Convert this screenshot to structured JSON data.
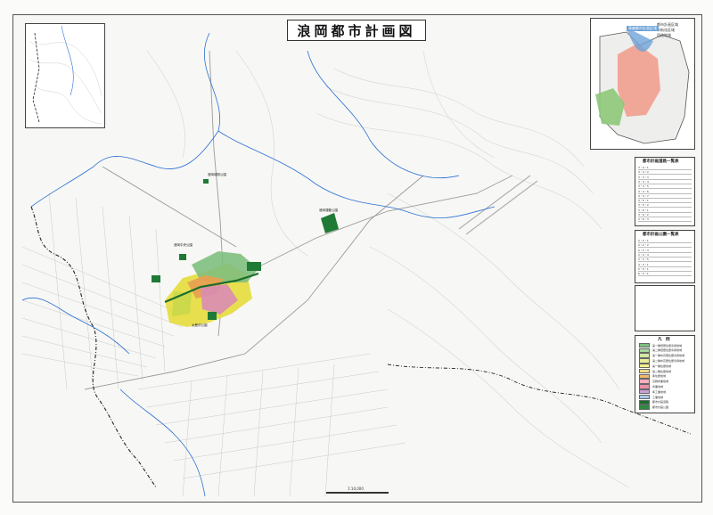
{
  "title": "浪岡都市計画図",
  "scale_label": "1:10,000",
  "locator": {
    "legend": [
      "都市計画区域",
      "市街化区域",
      "用途地域"
    ],
    "label": "青森都市計画区域"
  },
  "table1": {
    "title": "都市計画道路一覧表",
    "rows": [
      "3・4・1",
      "3・4・2",
      "3・4・3",
      "3・4・4",
      "3・4・5",
      "3・4・6",
      "3・4・7",
      "3・5・1",
      "3・5・2",
      "3・6・1",
      "3・6・2",
      "3・6・3"
    ]
  },
  "table2": {
    "title": "都市計画公園一覧表",
    "rows": [
      "2・2・1",
      "2・2・2",
      "2・2・3",
      "2・2・4",
      "2・2・5",
      "3・3・1",
      "5・5・1",
      "6・5・1"
    ]
  },
  "legend": {
    "title": "凡　例",
    "items": [
      {
        "label": "第一種低層住居専用地域",
        "color": "#7fbf7f"
      },
      {
        "label": "第二種低層住居専用地域",
        "color": "#a8d8a0"
      },
      {
        "label": "第一種中高層住居専用地域",
        "color": "#d2e8a0"
      },
      {
        "label": "第二種中高層住居専用地域",
        "color": "#e8ec9a"
      },
      {
        "label": "第一種住居地域",
        "color": "#f3ed8a"
      },
      {
        "label": "第二種住居地域",
        "color": "#f3d98a"
      },
      {
        "label": "準住居地域",
        "color": "#f0b86a"
      },
      {
        "label": "近隣商業地域",
        "color": "#f4b0c0"
      },
      {
        "label": "商業地域",
        "color": "#e890a8"
      },
      {
        "label": "準工業地域",
        "color": "#c8a0d8"
      },
      {
        "label": "工業地域",
        "color": "#a8c8e8"
      },
      {
        "label": "都市計画道路",
        "color": "#1a6e2e"
      },
      {
        "label": "都市計画公園",
        "color": "#2e8a3c"
      }
    ]
  },
  "colors": {
    "river": "#2b6fd1",
    "park": "#1f7a35",
    "residential": "#c8d84a",
    "yellow_zone": "#e6dc3c",
    "commercial": "#d98cb4",
    "orange_zone": "#e8a050",
    "boundary": "#222222"
  },
  "place_labels": [
    "浪岡城跡公園",
    "浪岡中央公園",
    "浪岡運動公園",
    "女鹿沢公園"
  ]
}
